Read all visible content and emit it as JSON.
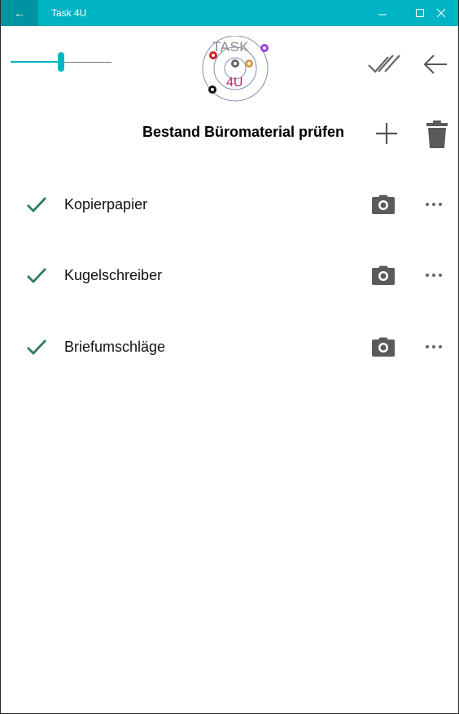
{
  "window": {
    "title": "Task 4U",
    "back_glyph": "←",
    "accent": "#00b4c4"
  },
  "header": {
    "zoom_slider_fraction": 0.5,
    "logo_text_top": "TASK",
    "logo_text_bottom": "4U"
  },
  "list": {
    "title": "Bestand Büromaterial prüfen",
    "items": [
      {
        "label": "Kopierpapier",
        "checked": true
      },
      {
        "label": "Kugelschreiber",
        "checked": true
      },
      {
        "label": "Briefumschläge",
        "checked": true
      }
    ]
  },
  "icons": {
    "check": "check-icon",
    "camera": "camera-icon",
    "more": "more-horizontal-icon",
    "add": "plus-icon",
    "delete": "trash-icon",
    "check_all": "double-check-icon",
    "back": "arrow-left-icon"
  },
  "colors": {
    "check_green": "#2e7d5b",
    "icon_gray": "#5a5a5a"
  }
}
